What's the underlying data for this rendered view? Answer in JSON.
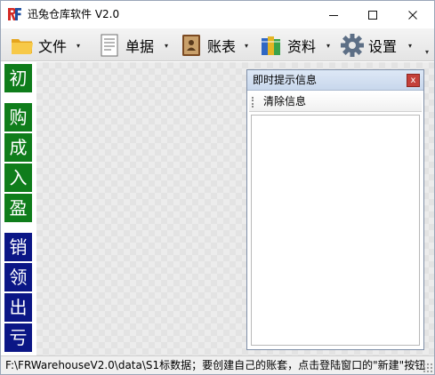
{
  "window": {
    "title": "迅兔仓库软件 V2.0",
    "controls": {
      "minimize": "—",
      "maximize": "☐",
      "close": "✕"
    }
  },
  "toolbar": {
    "items": [
      {
        "label": "文件",
        "icon": "folder-icon"
      },
      {
        "label": "单据",
        "icon": "document-icon"
      },
      {
        "label": "账表",
        "icon": "ledger-book-icon"
      },
      {
        "label": "资料",
        "icon": "binders-icon"
      },
      {
        "label": "设置",
        "icon": "gear-icon"
      }
    ],
    "dropdown_glyph": "▾",
    "overflow_glyph": "▾"
  },
  "leftnav": {
    "green_buttons": [
      "初",
      "购",
      "成",
      "入",
      "盈"
    ],
    "navy_buttons": [
      "销",
      "领",
      "出",
      "亏"
    ]
  },
  "info_panel": {
    "title": "即时提示信息",
    "close_glyph": "x",
    "clear_button": "清除信息"
  },
  "statusbar": {
    "text": "F:\\FRWarehouseV2.0\\data\\S1标数据；要创建自己的账套，点击登陆窗口的\"新建\"按钮"
  },
  "colors": {
    "nav_green": "#0f7d1b",
    "nav_navy": "#0b1686",
    "panel_close": "#c4403a",
    "logo_red": "#d42a25",
    "logo_blue": "#1f4fa0"
  }
}
